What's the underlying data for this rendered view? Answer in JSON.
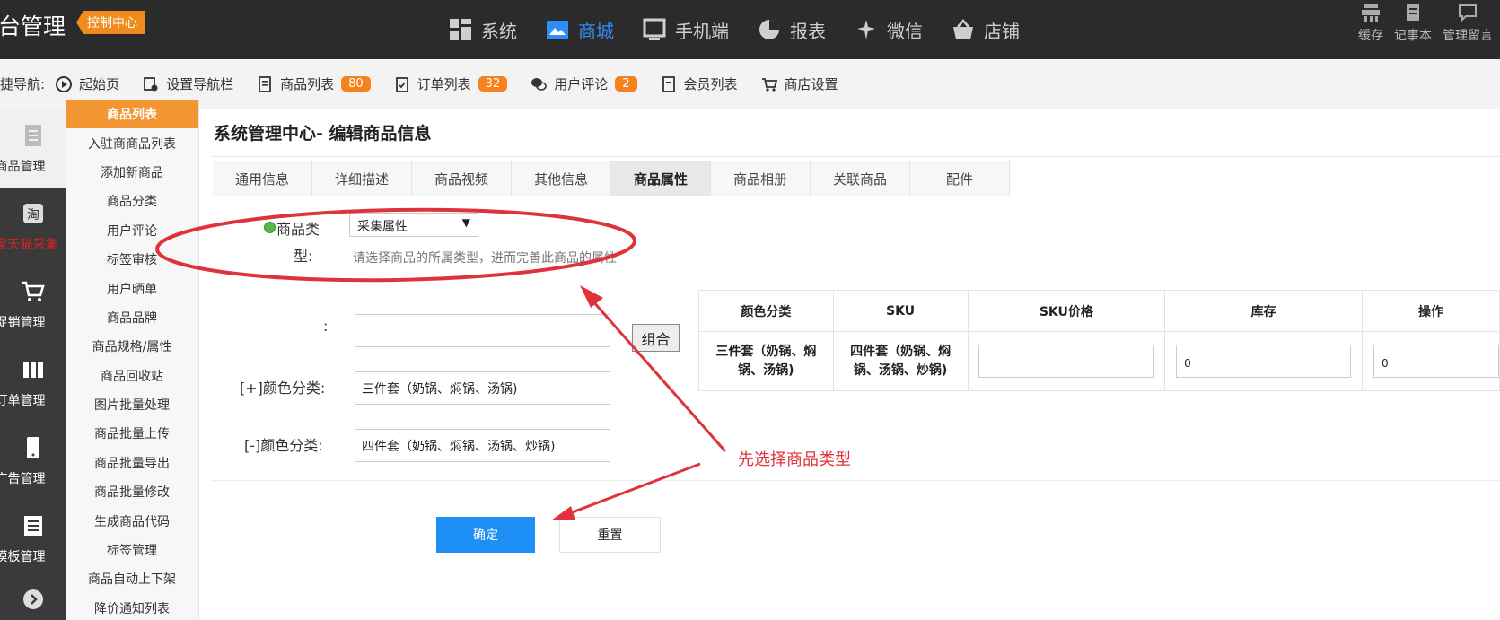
{
  "header": {
    "brand": "后台管理",
    "badge": "控制中心",
    "nav": [
      {
        "label": "系统",
        "icon": "grid-icon"
      },
      {
        "label": "商城",
        "icon": "shop-window-icon"
      },
      {
        "label": "手机端",
        "icon": "monitor-icon"
      },
      {
        "label": "报表",
        "icon": "pie-chart-icon"
      },
      {
        "label": "微信",
        "icon": "wechat-icon"
      },
      {
        "label": "店铺",
        "icon": "basket-icon"
      }
    ],
    "actions": [
      {
        "label": "缓存",
        "icon": "cache-icon"
      },
      {
        "label": "记事本",
        "icon": "notebook-icon"
      },
      {
        "label": "管理留言",
        "icon": "message-icon"
      }
    ]
  },
  "quicknav": {
    "label": "快捷导航:",
    "items": [
      {
        "label": "起始页",
        "badge": ""
      },
      {
        "label": "设置导航栏",
        "badge": ""
      },
      {
        "label": "商品列表",
        "badge": "80"
      },
      {
        "label": "订单列表",
        "badge": "32"
      },
      {
        "label": "用户评论",
        "badge": "2"
      },
      {
        "label": "会员列表",
        "badge": ""
      },
      {
        "label": "商店设置",
        "badge": ""
      }
    ]
  },
  "leftnav": {
    "items": [
      {
        "label": "商品管理",
        "icon": "document-icon"
      },
      {
        "label": "淘宝天猫采集",
        "icon": "taobao-icon"
      },
      {
        "label": "促销管理",
        "icon": "cart-icon"
      },
      {
        "label": "订单管理",
        "icon": "orders-icon"
      },
      {
        "label": "广告管理",
        "icon": "phone-icon"
      },
      {
        "label": "模板管理",
        "icon": "template-icon"
      }
    ]
  },
  "submenu": {
    "items": [
      "商品列表",
      "入驻商商品列表",
      "添加新商品",
      "商品分类",
      "用户评论",
      "标签审核",
      "用户晒单",
      "商品品牌",
      "商品规格/属性",
      "商品回收站",
      "图片批量处理",
      "商品批量上传",
      "商品批量导出",
      "商品批量修改",
      "生成商品代码",
      "标签管理",
      "商品自动上下架",
      "降价通知列表"
    ]
  },
  "main": {
    "title": "系统管理中心- 编辑商品信息",
    "tabs": [
      "通用信息",
      "详细描述",
      "商品视频",
      "其他信息",
      "商品属性",
      "商品相册",
      "关联商品",
      "配件"
    ],
    "form": {
      "type_label_1": "商品类",
      "type_label_2": "型:",
      "type_value": "采集属性",
      "type_hint": "请选择商品的所属类型，进而完善此商品的属性",
      "colon_label": ":",
      "combine_button": "组合",
      "color_plus_label": "[+]颜色分类:",
      "color_plus_value": "三件套（奶锅、焖锅、汤锅)",
      "color_minus_label": "[-]颜色分类:",
      "color_minus_value": "四件套（奶锅、焖锅、汤锅、炒锅)"
    },
    "sku_table": {
      "headers": [
        "颜色分类",
        "SKU",
        "SKU价格",
        "库存",
        "操作"
      ],
      "row": {
        "color": "三件套（奶锅、焖锅、汤锅)",
        "sku": "四件套（奶锅、焖锅、汤锅、炒锅)",
        "price": "",
        "stock": "0",
        "op_value": "0"
      }
    },
    "buttons": {
      "confirm": "确定",
      "reset": "重置"
    },
    "annotation": "先选择商品类型"
  },
  "colors": {
    "accent_blue": "#1e8ff5",
    "accent_orange": "#f29634",
    "annotation_red": "#e0323a",
    "topbar": "#2b2b2b"
  }
}
